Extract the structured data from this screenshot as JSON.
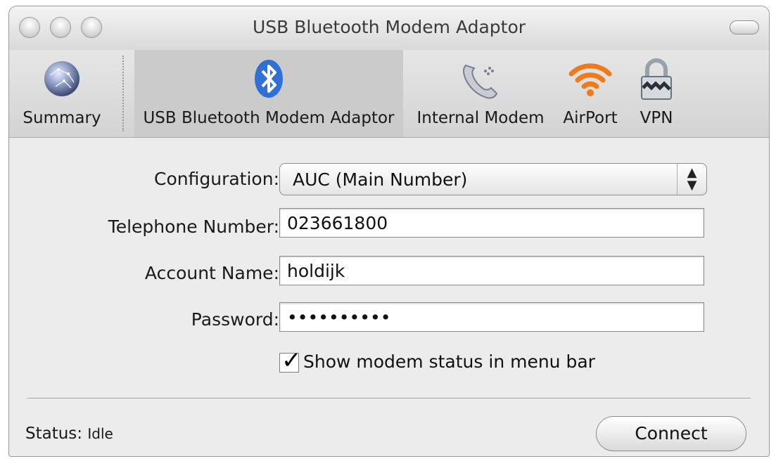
{
  "window": {
    "title": "USB Bluetooth Modem Adaptor"
  },
  "toolbar": {
    "items": [
      {
        "label": "Summary",
        "icon": "globe-icon"
      },
      {
        "label": "USB Bluetooth Modem Adaptor",
        "icon": "bluetooth-icon",
        "selected": true
      },
      {
        "label": "Internal Modem",
        "icon": "phone-icon"
      },
      {
        "label": "AirPort",
        "icon": "wifi-icon"
      },
      {
        "label": "VPN",
        "icon": "lock-icon"
      }
    ]
  },
  "form": {
    "configuration_label": "Configuration:",
    "configuration_value": "AUC (Main Number)",
    "telephone_label": "Telephone Number:",
    "telephone_value": "023661800",
    "account_label": "Account Name:",
    "account_value": "holdijk",
    "password_label": "Password:",
    "password_value": "••••••••••",
    "show_status_label": "Show modem status in menu bar",
    "show_status_checked": true
  },
  "footer": {
    "status_label": "Status:",
    "status_value": "Idle",
    "connect_label": "Connect"
  },
  "colors": {
    "airport_orange": "#f07a1a",
    "bluetooth_blue": "#2f6fd6"
  }
}
